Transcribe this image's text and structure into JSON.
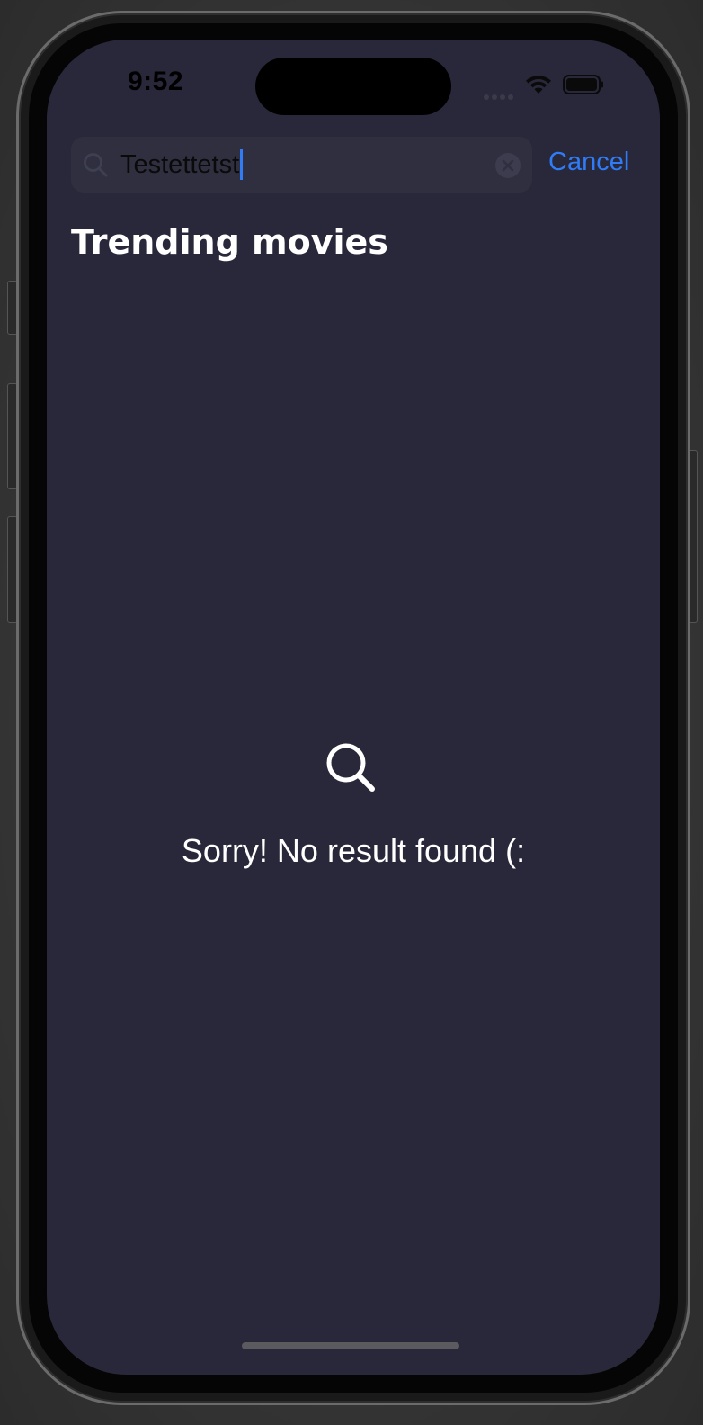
{
  "status_bar": {
    "time": "9:52",
    "icons": [
      "cellular-signal-icon",
      "wifi-icon",
      "battery-icon"
    ]
  },
  "search": {
    "icon": "search-icon",
    "value": "Testettetst",
    "clear_icon": "clear-circle-icon"
  },
  "header": {
    "cancel_label": "Cancel",
    "section_title": "Trending movies"
  },
  "empty_state": {
    "icon": "search-icon",
    "message": "Sorry! No result found (:"
  },
  "colors": {
    "background": "#28283a",
    "search_field": "#2f2f40",
    "accent": "#2f7cf6",
    "text_primary": "#ffffff"
  }
}
